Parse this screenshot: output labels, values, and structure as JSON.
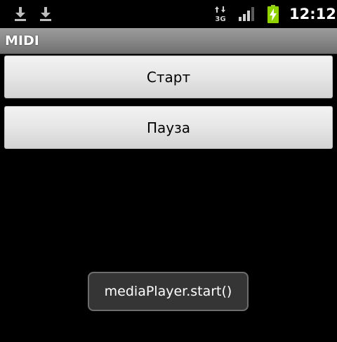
{
  "status_bar": {
    "icons": [
      "download-icon",
      "download-icon",
      "3g-data-icon",
      "signal-strength-icon",
      "battery-charging-icon"
    ],
    "time": "12:12"
  },
  "app": {
    "title": "MIDI"
  },
  "buttons": {
    "start_label": "Старт",
    "pause_label": "Пауза"
  },
  "toast": {
    "message": "mediaPlayer.start()"
  },
  "colors": {
    "background": "#000000",
    "title_bar": "#8a8a8a",
    "battery_charge": "#8fd400",
    "toast_bg": "#353535"
  }
}
